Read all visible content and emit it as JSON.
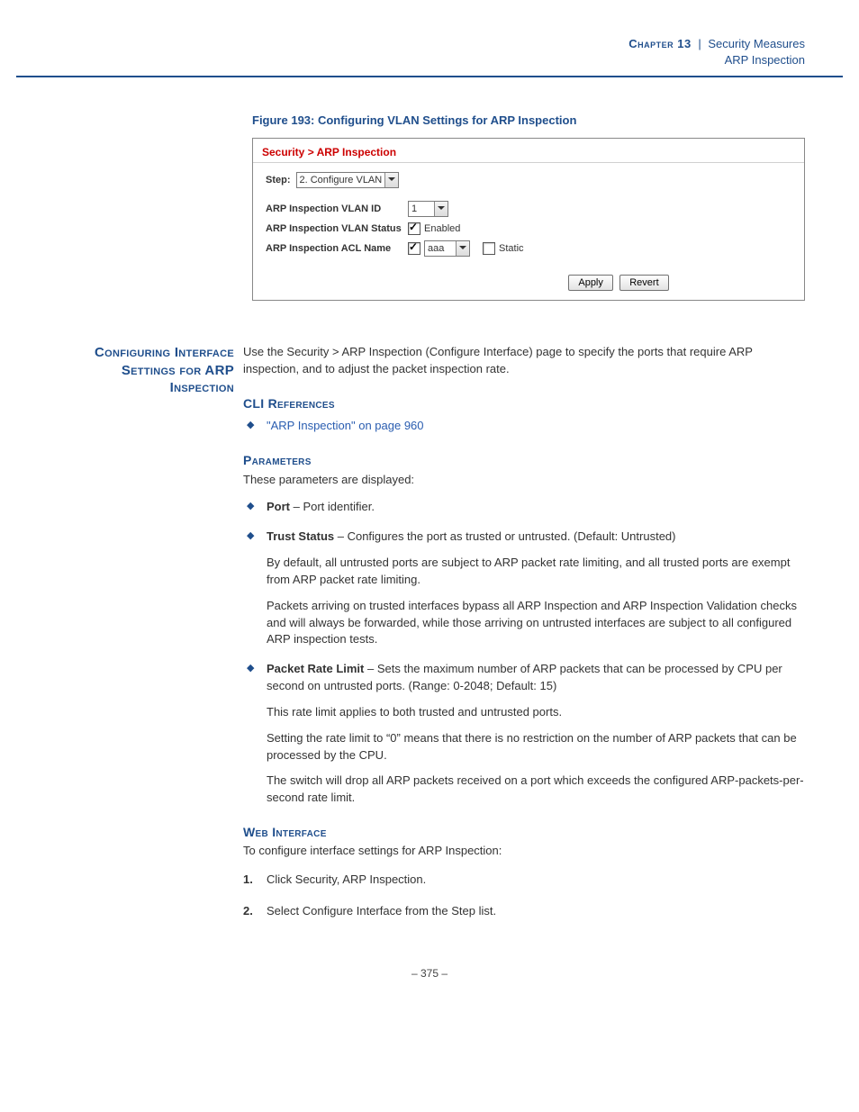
{
  "header": {
    "chapter": "Chapter 13",
    "title": "Security Measures",
    "subtitle": "ARP Inspection"
  },
  "figure": {
    "caption": "Figure 193:  Configuring VLAN Settings for ARP Inspection",
    "breadcrumb": "Security > ARP Inspection",
    "step_label": "Step:",
    "step_value": "2. Configure VLAN",
    "rows": {
      "vlan_id_label": "ARP Inspection VLAN ID",
      "vlan_id_value": "1",
      "vlan_status_label": "ARP Inspection VLAN Status",
      "vlan_status_text": "Enabled",
      "acl_name_label": "ARP Inspection ACL Name",
      "acl_name_value": "aaa",
      "static_label": "Static"
    },
    "buttons": {
      "apply": "Apply",
      "revert": "Revert"
    }
  },
  "section": {
    "side_heading": "Configuring Interface Settings for ARP Inspection",
    "intro": "Use the Security > ARP Inspection (Configure Interface) page to specify the ports that require ARP inspection, and to adjust the packet inspection rate.",
    "cli_heading": "CLI References",
    "cli_link": "\"ARP Inspection\" on page 960",
    "params_heading": "Parameters",
    "params_intro": "These parameters are displayed:",
    "params": {
      "port": {
        "term": "Port",
        "desc": " – Port identifier."
      },
      "trust": {
        "term": "Trust Status",
        "desc": " – Configures the port as trusted or untrusted. (Default: Untrusted)",
        "p1": "By default, all untrusted ports are subject to ARP packet rate limiting, and all trusted ports are exempt from ARP packet rate limiting.",
        "p2": "Packets arriving on trusted interfaces bypass all ARP Inspection and ARP Inspection Validation checks and will always be forwarded, while those arriving on untrusted interfaces are subject to all configured ARP inspection tests."
      },
      "rate": {
        "term": "Packet Rate Limit",
        "desc": " – Sets the maximum number of ARP packets that can be processed by CPU per second on untrusted ports. (Range: 0-2048; Default: 15)",
        "p1": "This rate limit applies to both trusted and untrusted ports.",
        "p2": "Setting the rate limit to “0” means that there is no restriction on the number of ARP packets that can be processed by the CPU.",
        "p3": "The switch will drop all ARP packets received on a port which exceeds the configured ARP-packets-per-second rate limit."
      }
    },
    "web_heading": "Web Interface",
    "web_intro": "To configure interface settings for ARP Inspection:",
    "steps": {
      "s1": "Click Security, ARP Inspection.",
      "s2": "Select Configure Interface from the Step list."
    }
  },
  "footer": {
    "page": "–  375  –"
  }
}
